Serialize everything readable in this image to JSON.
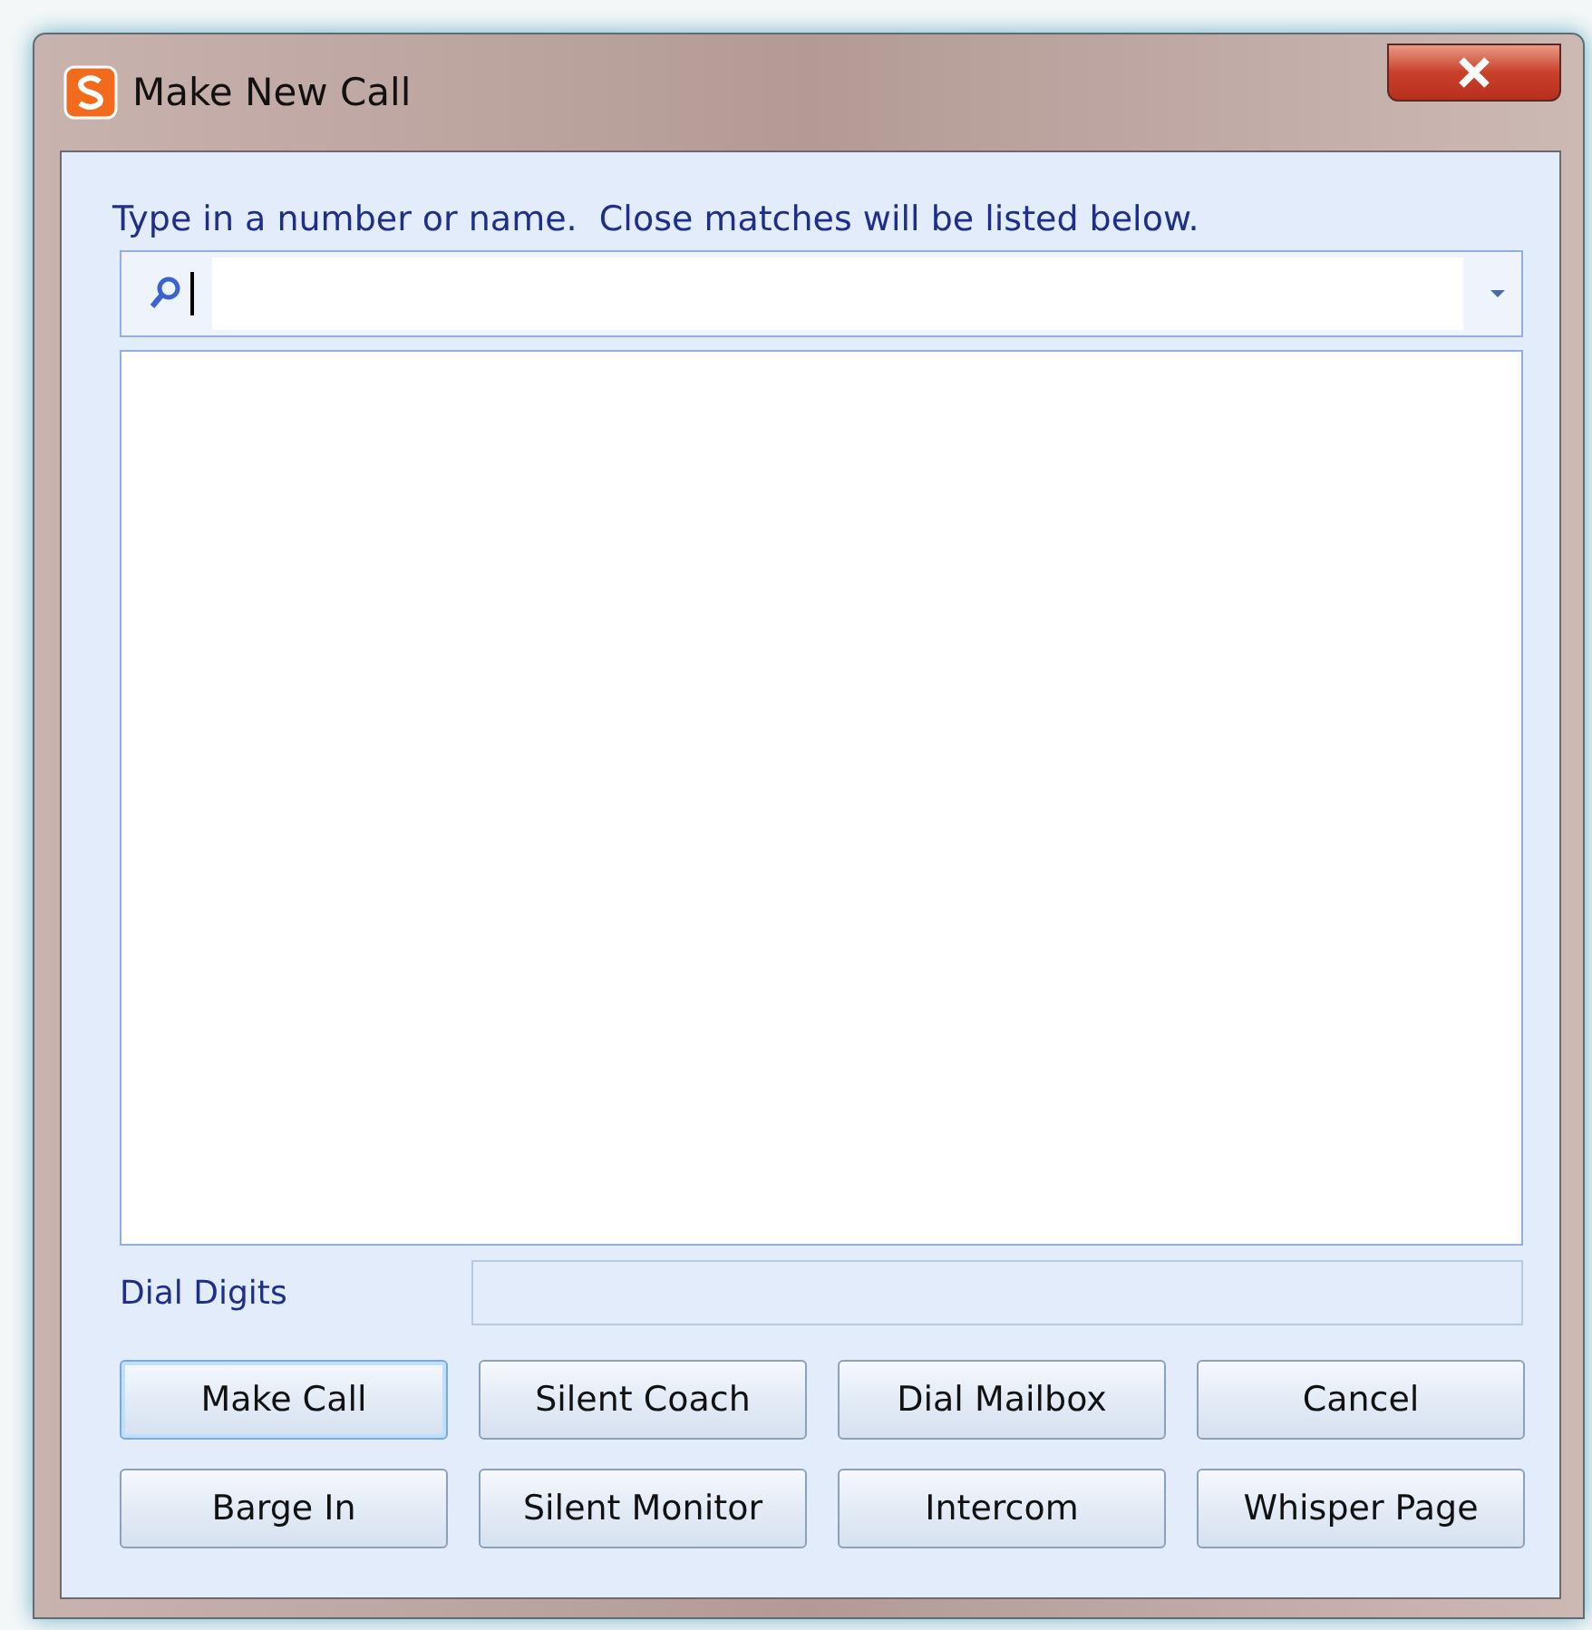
{
  "window": {
    "title": "Make New Call"
  },
  "search": {
    "label": "Type in a number or name.  Close matches will be listed below."
  },
  "dial_digits": {
    "label": "Dial Digits"
  },
  "buttons": [
    {
      "label": "Make Call",
      "default": true
    },
    {
      "label": "Silent Coach",
      "default": false
    },
    {
      "label": "Dial Mailbox",
      "default": false
    },
    {
      "label": "Cancel",
      "default": false
    },
    {
      "label": "Barge In",
      "default": false
    },
    {
      "label": "Silent Monitor",
      "default": false
    },
    {
      "label": "Intercom",
      "default": false
    },
    {
      "label": "Whisper Page",
      "default": false
    }
  ]
}
